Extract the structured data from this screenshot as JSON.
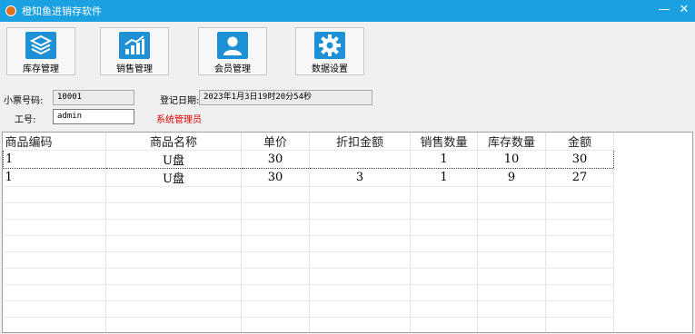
{
  "window": {
    "title": "橙知鱼进销存软件",
    "minimize_glyph": "—",
    "close_glyph": "✕"
  },
  "toolbar": {
    "items": [
      {
        "label": "库存管理",
        "icon": "layers-icon"
      },
      {
        "label": "销售管理",
        "icon": "bar-chart-icon"
      },
      {
        "label": "会员管理",
        "icon": "user-icon"
      },
      {
        "label": "数据设置",
        "icon": "gear-icon"
      }
    ]
  },
  "form": {
    "receipt_label": "小票号码:",
    "receipt_value": "10001",
    "date_label": "登记日期:",
    "date_value": "2023年1月3日19时20分54秒",
    "employee_label": "工号:",
    "employee_value": "admin",
    "role_text": "系统管理员"
  },
  "grid": {
    "columns": [
      "商品编码",
      "商品名称",
      "单价",
      "折扣金额",
      "销售数量",
      "库存数量",
      "金额"
    ],
    "rows": [
      [
        "1",
        "U盘",
        "30",
        "",
        "1",
        "10",
        "30"
      ],
      [
        "1",
        "U盘",
        "30",
        "3",
        "1",
        "9",
        "27"
      ]
    ]
  },
  "colors": {
    "titlebar": "#1ba1e2",
    "icon_blue": "#1e90d6",
    "role_text": "#e00000"
  }
}
